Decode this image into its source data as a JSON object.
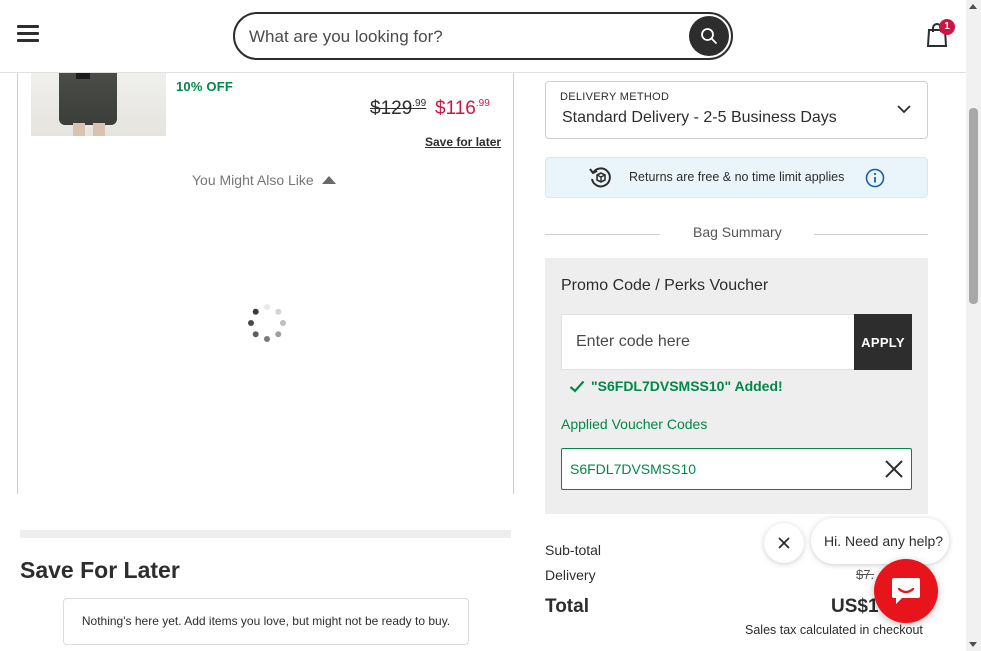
{
  "header": {
    "search_placeholder": "What are you looking for?",
    "bag_count": "1"
  },
  "product": {
    "discount": "10% OFF",
    "old_price_main": "$129",
    "old_price_cents": ".99",
    "new_price_main": "$116",
    "new_price_cents": ".99",
    "save_for_later": "Save for later"
  },
  "recommendations": {
    "title": "You Might Also Like"
  },
  "save_for_later": {
    "title": "Save For Later",
    "empty_message": "Nothing's here yet. Add items you love, but might not be ready to buy."
  },
  "delivery": {
    "label": "DELIVERY METHOD",
    "value": "Standard Delivery - 2-5 Business Days"
  },
  "returns": {
    "text": "Returns are free & no time limit applies"
  },
  "bag_summary": {
    "title": "Bag Summary"
  },
  "promo": {
    "title": "Promo Code / Perks Voucher",
    "input_placeholder": "Enter code here",
    "apply_label": "APPLY",
    "added_message": "\"S6FDL7DVSMSS10\" Added!",
    "applied_label": "Applied Voucher Codes",
    "applied_code": "S6FDL7DVSMSS10"
  },
  "totals": {
    "subtotal_label": "Sub-total",
    "delivery_label": "Delivery",
    "delivery_value": "$7.",
    "total_label": "Total",
    "total_value": "US$1",
    "tax_note": "Sales tax calculated in checkout"
  },
  "chat": {
    "greeting": "Hi. Need any help?"
  },
  "colors": {
    "accent_green": "#018849",
    "sale_red": "#d01345",
    "dark": "#2d2d2d",
    "chat_red": "#e8141c"
  }
}
